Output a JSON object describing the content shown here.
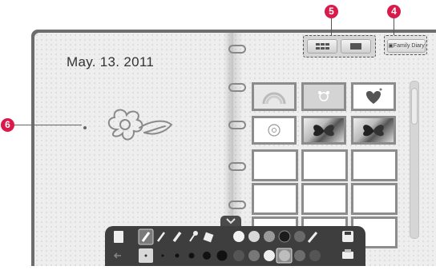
{
  "diary": {
    "date": "May. 13. 2011"
  },
  "family_button": {
    "label": "Family Diary"
  },
  "callouts": {
    "four": "4",
    "five": "5",
    "six": "6"
  },
  "colors": {
    "callout": "#d81b4a",
    "frame": "#6d6d6d",
    "page": "#eeeeee",
    "toolbar": "#3e3e3e"
  },
  "thumbnails": [
    "rainbow",
    "bear-face",
    "heart",
    "flower",
    "butterfly-photo",
    "butterfly-photo",
    "blank",
    "blank",
    "blank",
    "blank",
    "blank",
    "blank",
    "blank",
    "blank",
    "blank"
  ],
  "toolbar": {
    "row1": [
      "new-page-icon",
      "pen-icon",
      "pen-icon",
      "brush-icon",
      "stamp-icon",
      "eraser-icon",
      "color-white",
      "color-lightgray",
      "color-gray",
      "color-black",
      "color-darkgray",
      "palette-icon",
      "save-icon"
    ],
    "row2": [
      "undo-icon",
      "size-1",
      "size-2",
      "size-3",
      "size-4",
      "size-5",
      "color-gray",
      "color-gray",
      "color-white",
      "color-selected",
      "color-gray",
      "color-gray",
      "print-icon"
    ]
  }
}
